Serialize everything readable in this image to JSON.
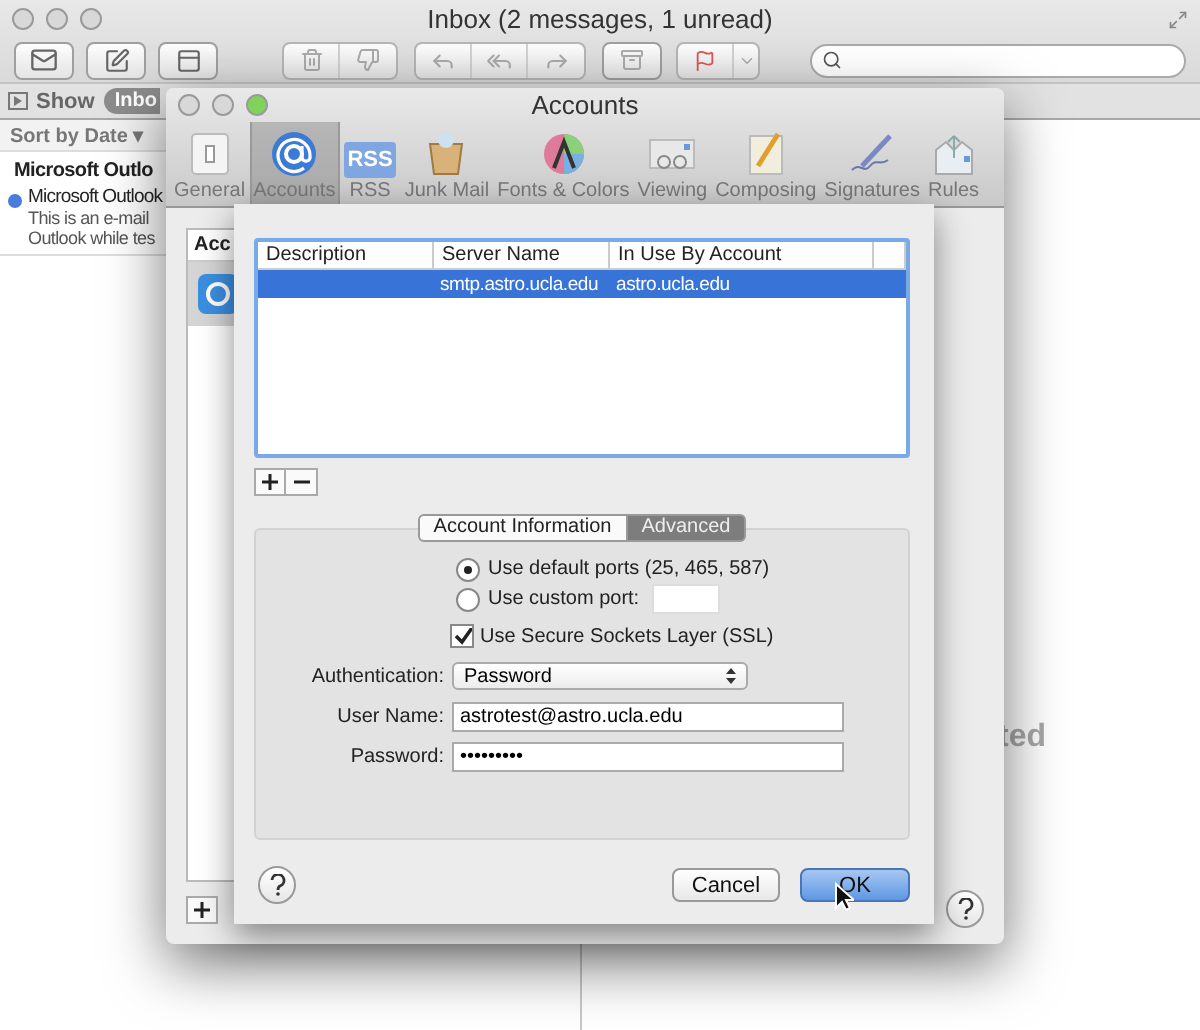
{
  "mail_window": {
    "title": "Inbox (2 messages, 1 unread)",
    "show_button": "Show",
    "mailbox_pill": "Inbo",
    "sort_label": "Sort by Date ▾",
    "message": {
      "sender": "Microsoft Outlo",
      "subject": "Microsoft Outlook",
      "preview": [
        "This is an e-mail",
        "Outlook while tes"
      ],
      "unread": true
    },
    "viewer_text": "ted"
  },
  "accounts_window": {
    "title": "Accounts",
    "toolbar": [
      {
        "label": "General",
        "kind": "general",
        "selected": false
      },
      {
        "label": "Accounts",
        "kind": "at",
        "selected": true
      },
      {
        "label": "RSS",
        "kind": "rss",
        "icon_text": "RSS",
        "selected": false
      },
      {
        "label": "Junk Mail",
        "kind": "junk",
        "selected": false
      },
      {
        "label": "Fonts & Colors",
        "kind": "fonts",
        "selected": false
      },
      {
        "label": "Viewing",
        "kind": "viewing",
        "selected": false
      },
      {
        "label": "Composing",
        "kind": "composing",
        "selected": false
      },
      {
        "label": "Signatures",
        "kind": "signatures",
        "selected": false
      },
      {
        "label": "Rules",
        "kind": "rules",
        "selected": false
      }
    ],
    "list_header": "Acc"
  },
  "sheet": {
    "columns": [
      "Description",
      "Server Name",
      "In Use By Account"
    ],
    "rows": [
      {
        "server_name": "smtp.astro.ucla.edu",
        "in_use_by": "astro.ucla.edu",
        "selected": true
      }
    ],
    "tabs": [
      {
        "label": "Account Information",
        "selected": false
      },
      {
        "label": "Advanced",
        "selected": true
      }
    ],
    "ports": [
      {
        "label": "Use default ports (25, 465, 587)",
        "selected": true
      },
      {
        "label": "Use custom port:",
        "selected": false
      }
    ],
    "ssl": {
      "label": "Use Secure Sockets Layer (SSL)",
      "checked": true
    },
    "authentication": {
      "label": "Authentication:",
      "value": "Password"
    },
    "user_name": {
      "label": "User Name:",
      "value": "astrotest@astro.ucla.edu"
    },
    "password": {
      "label": "Password:",
      "value": "•••••••••"
    },
    "buttons": [
      {
        "label": "Cancel",
        "default": false
      },
      {
        "label": "OK",
        "default": true
      }
    ]
  }
}
